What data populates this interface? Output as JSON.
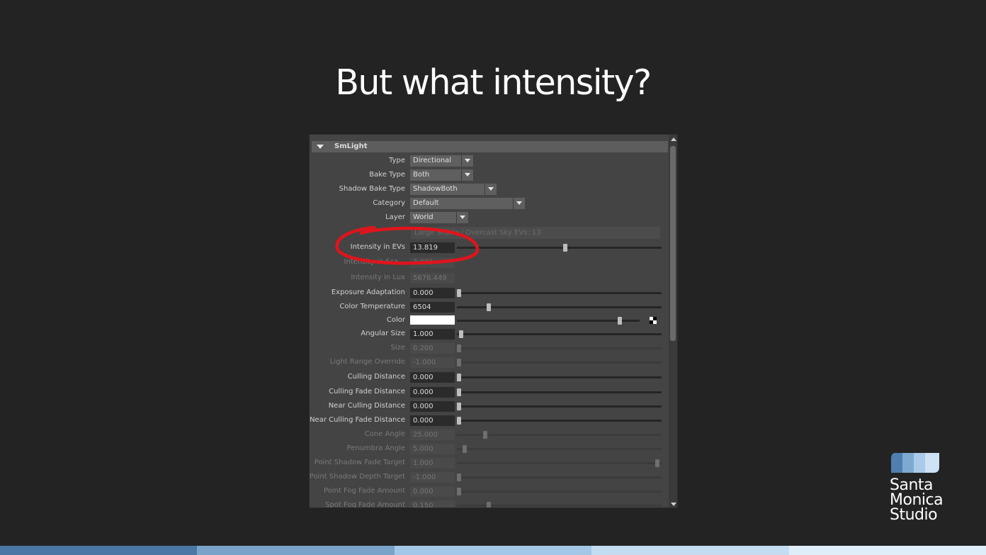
{
  "slide": {
    "title": "But what intensity?"
  },
  "panel": {
    "header": "SmLight",
    "dropdowns": [
      {
        "label": "Type",
        "value": "Directional"
      },
      {
        "label": "Bake Type",
        "value": "Both"
      },
      {
        "label": "Shadow Bake Type",
        "value": "ShadowBoth"
      },
      {
        "label": "Category",
        "value": "Default"
      },
      {
        "label": "Layer",
        "value": "World"
      }
    ],
    "info_text": "Large Shade / Overcast Sky EVs: 13",
    "attributes": [
      {
        "label": "Intensity in EVs",
        "value": "13.819",
        "enabled": true,
        "slider": 0.53
      },
      {
        "label": "Intensity in Sca...",
        "value": "3.000",
        "enabled": false
      },
      {
        "label": "Intensity in Lux",
        "value": "5676.449",
        "enabled": false
      },
      {
        "label": "Exposure Adaptation",
        "value": "0.000",
        "enabled": true,
        "slider": 0.0
      },
      {
        "label": "Color Temperature",
        "value": "6504",
        "enabled": true,
        "slider": 0.15
      },
      {
        "label": "Color",
        "value": "",
        "enabled": true,
        "slider": 0.9,
        "swatch": "#ffffff"
      },
      {
        "label": "Angular Size",
        "value": "1.000",
        "enabled": true,
        "slider": 0.01
      },
      {
        "label": "Size",
        "value": "0.200",
        "enabled": false,
        "slider": 0.0
      },
      {
        "label": "Light Range Override",
        "value": "-1.000",
        "enabled": false,
        "slider": 0.0
      },
      {
        "label": "Culling Distance",
        "value": "0.000",
        "enabled": true,
        "slider": 0.0
      },
      {
        "label": "Culling Fade Distance",
        "value": "0.000",
        "enabled": true,
        "slider": 0.0
      },
      {
        "label": "Near Culling Distance",
        "value": "0.000",
        "enabled": true,
        "slider": 0.0
      },
      {
        "label": "Near Culling Fade Distance",
        "value": "0.000",
        "enabled": true,
        "slider": 0.0
      },
      {
        "label": "Cone Angle",
        "value": "25.000",
        "enabled": false,
        "slider": 0.13
      },
      {
        "label": "Penumbra Angle",
        "value": "5.000",
        "enabled": false,
        "slider": 0.03
      },
      {
        "label": "Point Shadow Fade Target",
        "value": "1.000",
        "enabled": false,
        "slider": 0.99
      },
      {
        "label": "Point Shadow Depth Target",
        "value": "-1.000",
        "enabled": false,
        "slider": 0.0
      },
      {
        "label": "Point Fog Fade Amount",
        "value": "0.000",
        "enabled": false,
        "slider": 0.0
      },
      {
        "label": "Spot Fog Fade Amount",
        "value": "0.150",
        "enabled": false,
        "slider": 0.15
      }
    ]
  },
  "logo": {
    "line1": "Santa",
    "line2": "Monica",
    "line3": "Studio",
    "colors": [
      "#4f7fae",
      "#7ea9d1",
      "#a9cbe9",
      "#cde2f4"
    ]
  },
  "footer_colors": [
    "#4a77a3",
    "#7aa3c9",
    "#a3c7e6",
    "#c3dcf0",
    "#dfeef9"
  ],
  "annotation_color": "#e0141c"
}
